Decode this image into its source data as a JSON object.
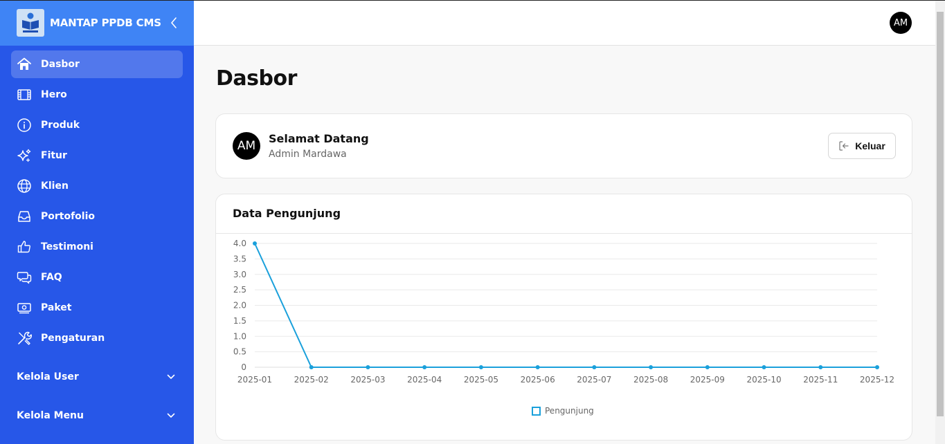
{
  "sidebar": {
    "brand": "MANTAP PPDB CMS",
    "logo_text": "MANTAP",
    "items": [
      {
        "label": "Dasbor",
        "icon": "home-icon",
        "active": true
      },
      {
        "label": "Hero",
        "icon": "film-icon"
      },
      {
        "label": "Produk",
        "icon": "info-icon"
      },
      {
        "label": "Fitur",
        "icon": "sparkles-icon"
      },
      {
        "label": "Klien",
        "icon": "globe-icon"
      },
      {
        "label": "Portofolio",
        "icon": "inbox-icon"
      },
      {
        "label": "Testimoni",
        "icon": "thumbs-up-icon"
      },
      {
        "label": "FAQ",
        "icon": "chat-bubbles-icon"
      },
      {
        "label": "Paket",
        "icon": "banknote-icon"
      },
      {
        "label": "Pengaturan",
        "icon": "tools-icon"
      }
    ],
    "groups": [
      {
        "label": "Kelola User",
        "icon": "chevron-down-icon"
      },
      {
        "label": "Kelola Menu",
        "icon": "chevron-down-icon"
      }
    ]
  },
  "header": {
    "avatar_initials": "AM"
  },
  "main": {
    "title": "Dasbor",
    "welcome": {
      "avatar_initials": "AM",
      "title": "Selamat Datang",
      "subtitle": "Admin Mardawa",
      "logout_label": "Keluar"
    },
    "chart_card_title": "Data Pengunjung"
  },
  "colors": {
    "sidebar": "#2757e8",
    "brand_bar": "#3f84f5",
    "line": "#1aa0db"
  },
  "chart_data": {
    "type": "line",
    "title": "Data Pengunjung",
    "x": [
      "2025-01",
      "2025-02",
      "2025-03",
      "2025-04",
      "2025-05",
      "2025-06",
      "2025-07",
      "2025-08",
      "2025-09",
      "2025-10",
      "2025-11",
      "2025-12"
    ],
    "y_ticks": [
      "4.0",
      "3.5",
      "3.0",
      "2.5",
      "2.0",
      "1.5",
      "1.0",
      "0.5",
      "0"
    ],
    "series": [
      {
        "name": "Pengunjung",
        "values": [
          4,
          0,
          0,
          0,
          0,
          0,
          0,
          0,
          0,
          0,
          0,
          0
        ]
      }
    ],
    "ylim": [
      0,
      4
    ],
    "grid": true,
    "legend": "bottom-center"
  }
}
